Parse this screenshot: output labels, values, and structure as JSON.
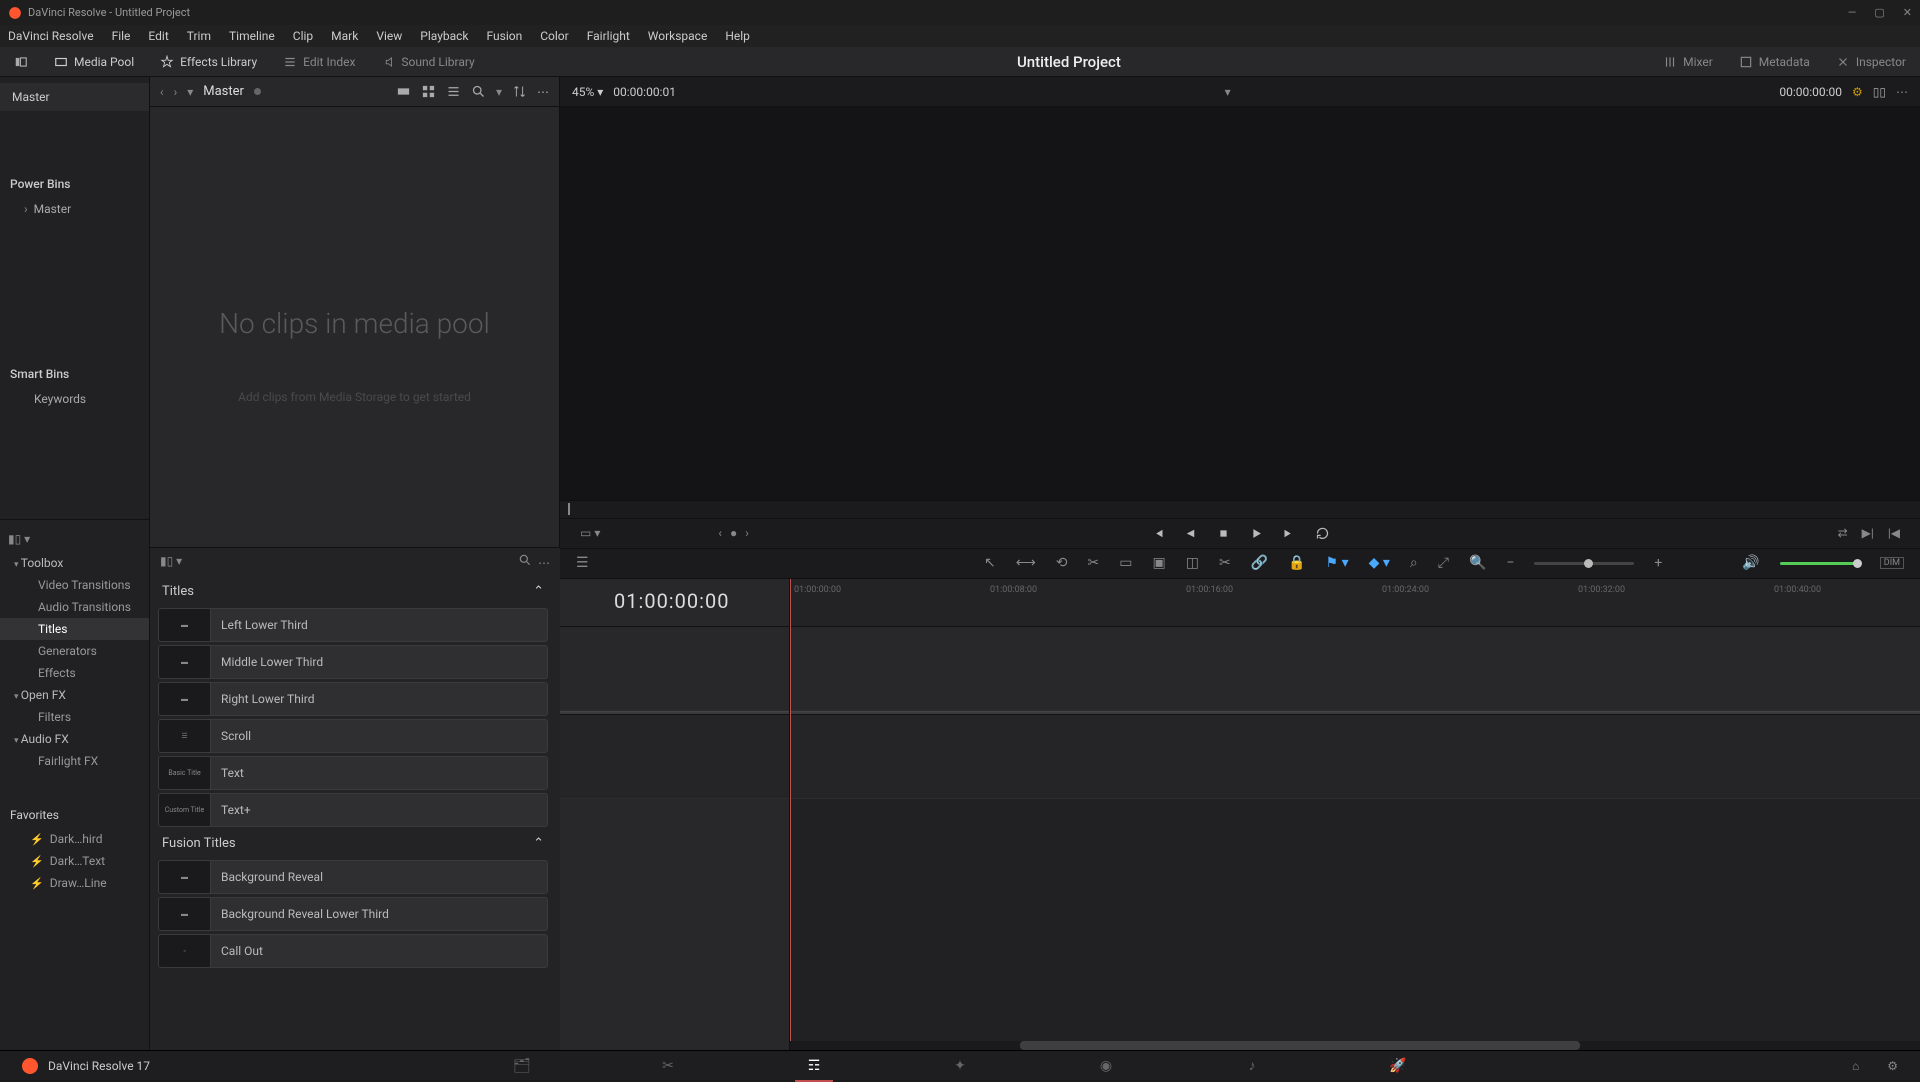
{
  "window": {
    "title": "DaVinci Resolve - Untitled Project"
  },
  "menu": [
    "DaVinci Resolve",
    "File",
    "Edit",
    "Trim",
    "Timeline",
    "Clip",
    "Mark",
    "View",
    "Playback",
    "Fusion",
    "Color",
    "Fairlight",
    "Workspace",
    "Help"
  ],
  "tabs": {
    "left": [
      {
        "label": "Media Pool",
        "active": true
      },
      {
        "label": "Effects Library",
        "active": true
      },
      {
        "label": "Edit Index",
        "active": false
      },
      {
        "label": "Sound Library",
        "active": false
      }
    ],
    "center": "Untitled Project",
    "right": [
      {
        "label": "Mixer"
      },
      {
        "label": "Metadata"
      },
      {
        "label": "Inspector"
      }
    ]
  },
  "pool": {
    "crumb": "Master",
    "bin_tree": {
      "root": "Master",
      "power_bins_label": "Power Bins",
      "power_bins_items": [
        "Master"
      ],
      "smart_bins_label": "Smart Bins",
      "smart_bins_items": [
        "Keywords"
      ]
    },
    "empty": {
      "heading": "No clips in media pool",
      "sub": "Add clips from Media Storage to get started"
    }
  },
  "fx_tree": {
    "toolbox": "Toolbox",
    "toolbox_items": [
      "Video Transitions",
      "Audio Transitions",
      "Titles",
      "Generators",
      "Effects"
    ],
    "openfx": "Open FX",
    "openfx_items": [
      "Filters"
    ],
    "audiofx": "Audio FX",
    "audiofx_items": [
      "Fairlight FX"
    ]
  },
  "favorites": {
    "label": "Favorites",
    "items": [
      "Dark…hird",
      "Dark…Text",
      "Draw…Line"
    ]
  },
  "effects": {
    "section_titles": "Titles",
    "titles": [
      {
        "label": "Left Lower Third",
        "thumb": ""
      },
      {
        "label": "Middle Lower Third",
        "thumb": ""
      },
      {
        "label": "Right Lower Third",
        "thumb": ""
      },
      {
        "label": "Scroll",
        "thumb": ""
      },
      {
        "label": "Text",
        "thumb": "Basic Title"
      },
      {
        "label": "Text+",
        "thumb": "Custom Title"
      }
    ],
    "section_fusion": "Fusion Titles",
    "fusion_titles": [
      {
        "label": "Background Reveal",
        "thumb": ""
      },
      {
        "label": "Background Reveal Lower Third",
        "thumb": ""
      },
      {
        "label": "Call Out",
        "thumb": ""
      }
    ]
  },
  "viewer": {
    "zoom": "45%",
    "src_tc": "00:00:00:01",
    "rec_tc": "00:00:00:00"
  },
  "timeline": {
    "tc": "01:00:00:00",
    "ticks": [
      "01:00:00:00",
      "01:00:08:00",
      "01:00:16:00",
      "01:00:24:00",
      "01:00:32:00",
      "01:00:40:00"
    ]
  },
  "pages": [
    "Media",
    "Cut",
    "Edit",
    "Fusion",
    "Color",
    "Fairlight",
    "Deliver"
  ],
  "version": "DaVinci Resolve 17"
}
